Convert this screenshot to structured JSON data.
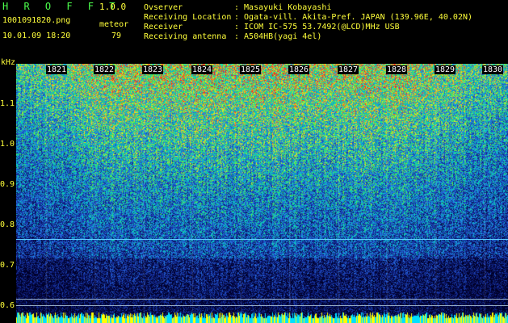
{
  "header": {
    "app_name": "H R O F F T",
    "version": "1.0.0",
    "filename": "1001091820.png",
    "mode": "meteor",
    "datetime": "10.01.09 18:20",
    "count": "79"
  },
  "info": {
    "rows": [
      {
        "key": "Ovserver",
        "value": ": Masayuki Kobayashi"
      },
      {
        "key": "Receiving Location",
        "value": ": Ogata-vill. Akita-Pref. JAPAN (139.96E, 40.02N)"
      },
      {
        "key": "Receiver",
        "value": ": ICOM IC-575 53.7492(@LCD)MHz USB"
      },
      {
        "key": "Receiving antenna",
        "value": ": A504HB(yagi 4el)"
      }
    ]
  },
  "axis": {
    "unit": "kHz",
    "time_ticks": [
      "1821",
      "1822",
      "1823",
      "1824",
      "1825",
      "1826",
      "1827",
      "1828",
      "1829",
      "1830"
    ],
    "freq_ticks": [
      "1.1",
      "1.0",
      "0.9",
      "0.8",
      "0.7",
      "0.6"
    ]
  },
  "colors": {
    "accent_green": "#4cff4c",
    "label_yellow": "#ffff3a",
    "marker_line": "#5ec8ff",
    "baseline_cyan": "#00e0ff",
    "baseline_yellow": "#ffff00"
  }
}
